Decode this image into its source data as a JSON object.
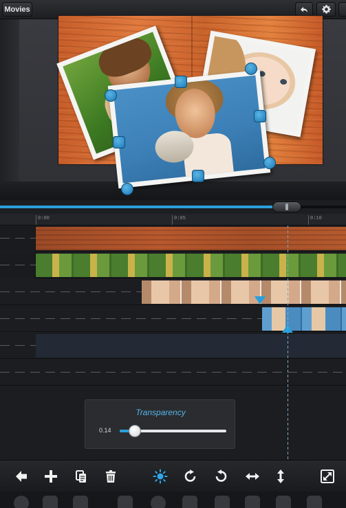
{
  "header": {
    "movies_label": "Movies",
    "undo_icon": "undo-icon",
    "settings_icon": "gear-icon"
  },
  "timeline": {
    "ruler_labels": [
      "0:00",
      "0:05",
      "0:10"
    ]
  },
  "transparency": {
    "title": "Transparency",
    "value": "0.14",
    "level": 0.14
  },
  "toolbar": {
    "icons": [
      "back-arrow-icon",
      "add-icon",
      "duplicate-icon",
      "trash-icon",
      "brightness-icon",
      "rotate-right-icon",
      "rotate-left-icon",
      "flip-horizontal-icon",
      "flip-vertical-icon",
      "fullscreen-icon"
    ]
  },
  "colors": {
    "accent": "#2a9fdc",
    "panel_title": "#57b4e6"
  }
}
